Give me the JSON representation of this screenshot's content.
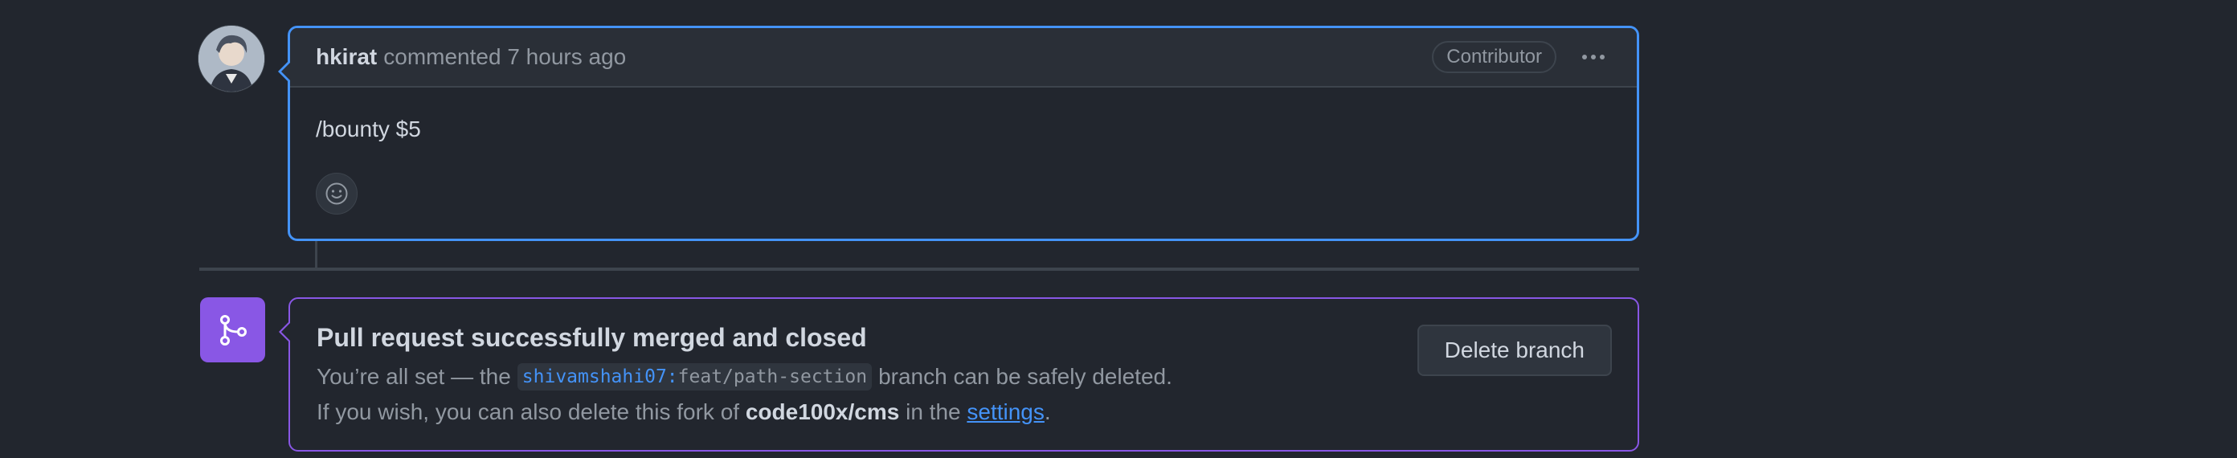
{
  "comment": {
    "author": "hkirat",
    "meta": "commented 7 hours ago",
    "badge": "Contributor",
    "body": "/bounty $5",
    "avatar_icon": "user-avatar",
    "menu_icon": "kebab-horizontal-icon",
    "reaction_icon": "smiley-icon"
  },
  "merge": {
    "icon": "git-merge-icon",
    "title": "Pull request successfully merged and closed",
    "line1_prefix": "You’re all set — the",
    "branch_owner": "shivamshahi07",
    "branch_sep": ":",
    "branch_name": "feat/path-section",
    "line1_suffix": "branch can be safely deleted.",
    "line2_prefix": "If you wish, you can also delete this fork of",
    "repo": "code100x/cms",
    "line2_mid": "in the",
    "settings_link": "settings",
    "line2_suffix": ".",
    "delete_button": "Delete branch"
  },
  "colors": {
    "background": "#22262e",
    "accent_blue": "#4493f8",
    "merged_purple": "#8957e5",
    "border": "#3d444d",
    "muted_text": "#9198a1"
  }
}
